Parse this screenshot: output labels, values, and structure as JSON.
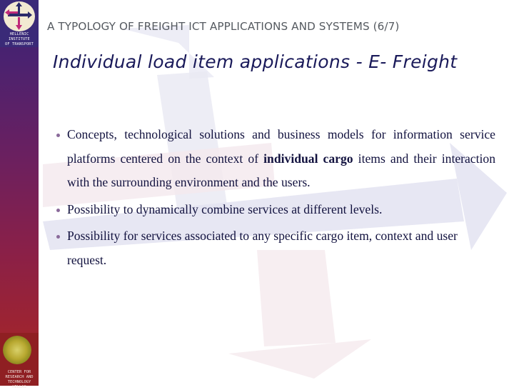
{
  "header": {
    "text": "A TYPOLOGY OF FREIGHT ICT APPLICATIONS AND SYSTEMS (6/7)"
  },
  "title": {
    "text": "Individual load item applications - E- Freight"
  },
  "logos": {
    "top": {
      "line1": "HELLENIC INSTITUTE",
      "line2": "OF TRANSPORT",
      "icon": "cross-arrows-logo-icon"
    },
    "bottom": {
      "line1": "CENTER FOR",
      "line2": "RESEARCH AND",
      "line3": "TECHNOLOGY",
      "line4": "HELLAS",
      "icon": "sun-emblem-logo-icon"
    }
  },
  "bullets": [
    {
      "text_before_bold": "Concepts, technological solutions and business models for information service platforms centered on the context of ",
      "bold": "individual cargo",
      "text_after_bold": " items and their interaction with the surrounding environment and the users."
    },
    {
      "text": "Possibility to dynamically combine services at different levels."
    },
    {
      "text": "Possibility for services associated to any specific cargo item, context and user request."
    }
  ],
  "colors": {
    "title": "#1a1a5a",
    "header": "#555a60",
    "body_text": "#12123f",
    "sidebar_top": "#3b2670",
    "sidebar_bottom": "#9a1e22"
  }
}
